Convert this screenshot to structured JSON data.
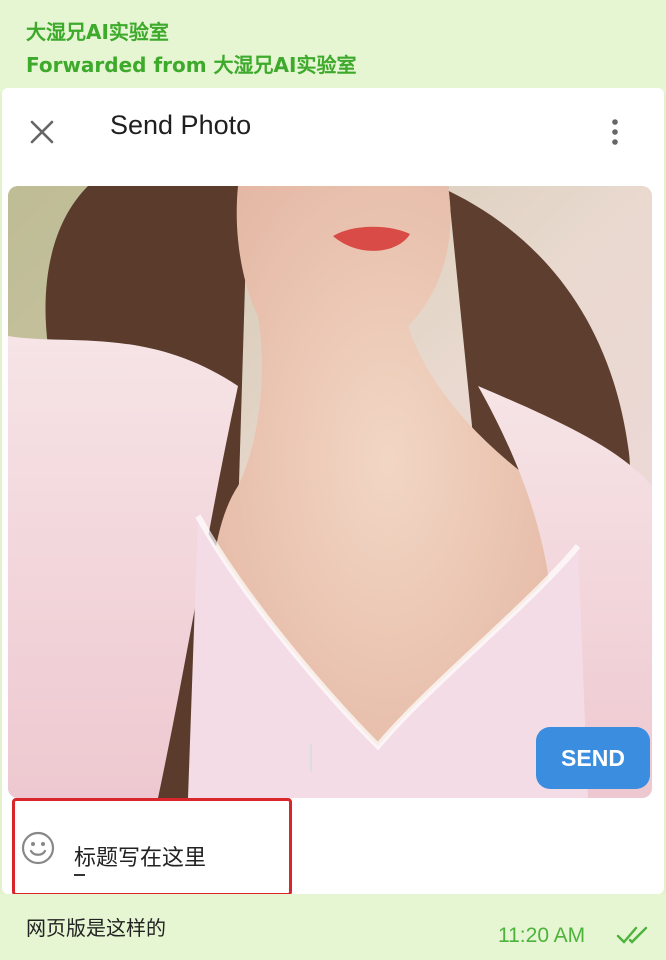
{
  "forward": {
    "channel_name": "大湿兄AI实验室",
    "forwarded_from": "Forwarded from 大湿兄AI实验室"
  },
  "dialog": {
    "title": "Send Photo",
    "close_icon": "close-icon",
    "more_icon": "more-vertical-icon",
    "photo_tools": [
      "image-settings-icon",
      "delete-icon"
    ],
    "caption": {
      "value": "标题写在这里",
      "emoji_icon": "emoji-icon"
    },
    "send_label": "SEND"
  },
  "message": {
    "text": "网页版是这样的",
    "time": "11:20 AM",
    "status_icon": "double-check-icon"
  },
  "colors": {
    "bubble": "#e6f5d2",
    "accent_green": "#3daa2c",
    "send_blue": "#3b8de0",
    "highlight_red": "#d9262b"
  }
}
